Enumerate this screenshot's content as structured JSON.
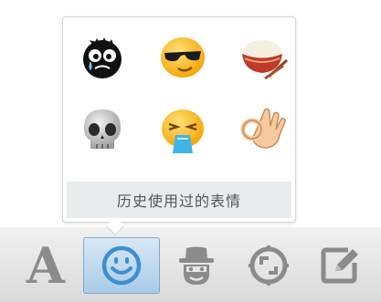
{
  "popup": {
    "emojis": [
      {
        "name": "crying-black-sweat-icon"
      },
      {
        "name": "cool-sunglasses-face-icon"
      },
      {
        "name": "rice-bowl-icon"
      },
      {
        "name": "skull-icon"
      },
      {
        "name": "vomiting-face-icon"
      },
      {
        "name": "ok-hand-icon"
      }
    ],
    "history_label": "历史使用过的表情"
  },
  "toolbar": {
    "items": [
      {
        "name": "font-a-icon",
        "glyph": "A"
      },
      {
        "name": "smiley-icon",
        "active": true
      },
      {
        "name": "hat-mask-icon"
      },
      {
        "name": "screenshot-icon"
      },
      {
        "name": "edit-icon"
      }
    ]
  },
  "colors": {
    "active_bg_top": "#d8e9f6",
    "active_bg_bottom": "#a8cbe7",
    "icon_gray": "#8b8b8b",
    "smiley_blue": "#3d8fd1",
    "history_bar_bg": "#e8ecef"
  }
}
